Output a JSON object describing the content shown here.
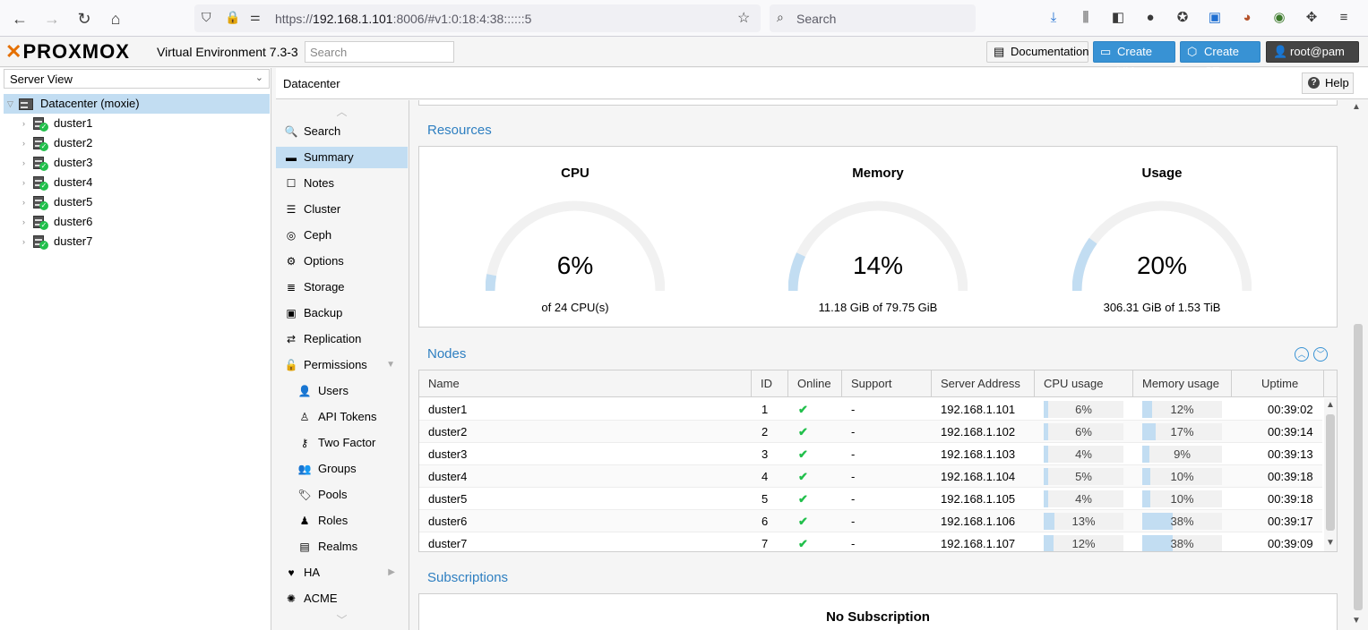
{
  "browser": {
    "url_prefix": "https://",
    "url_host": "192.168.1.101",
    "url_rest": ":8006/#v1:0:18:4:38::::::5",
    "search_placeholder": "Search"
  },
  "header": {
    "logo": "PROXMOX",
    "version": "Virtual Environment 7.3-3",
    "search_placeholder": "Search",
    "doc_label": "Documentation",
    "create_vm_label": "Create VM",
    "create_ct_label": "Create CT",
    "user_label": "root@pam"
  },
  "tree": {
    "view_label": "Server View",
    "datacenter_label": "Datacenter (moxie)",
    "nodes": [
      "duster1",
      "duster2",
      "duster3",
      "duster4",
      "duster5",
      "duster6",
      "duster7"
    ]
  },
  "content": {
    "title": "Datacenter",
    "help_label": "Help"
  },
  "menu": {
    "items": [
      {
        "label": "Search",
        "icon": "search-icon",
        "glyph": "🔍"
      },
      {
        "label": "Summary",
        "icon": "book-icon",
        "glyph": "▬",
        "selected": true
      },
      {
        "label": "Notes",
        "icon": "note-icon",
        "glyph": "☐"
      },
      {
        "label": "Cluster",
        "icon": "server-icon",
        "glyph": "☰"
      },
      {
        "label": "Ceph",
        "icon": "ceph-icon",
        "glyph": "◎"
      },
      {
        "label": "Options",
        "icon": "gear-icon",
        "glyph": "⚙"
      },
      {
        "label": "Storage",
        "icon": "database-icon",
        "glyph": "≣"
      },
      {
        "label": "Backup",
        "icon": "floppy-icon",
        "glyph": "▣"
      },
      {
        "label": "Replication",
        "icon": "retweet-icon",
        "glyph": "⇄"
      },
      {
        "label": "Permissions",
        "icon": "unlock-icon",
        "glyph": "🔓",
        "caret": "▼"
      },
      {
        "label": "Users",
        "icon": "user-icon",
        "glyph": "👤",
        "sub": true
      },
      {
        "label": "API Tokens",
        "icon": "user-outline-icon",
        "glyph": "♙",
        "sub": true
      },
      {
        "label": "Two Factor",
        "icon": "key-icon",
        "glyph": "⚷",
        "sub": true
      },
      {
        "label": "Groups",
        "icon": "users-icon",
        "glyph": "👥",
        "sub": true
      },
      {
        "label": "Pools",
        "icon": "tags-icon",
        "glyph": "🏷",
        "sub": true
      },
      {
        "label": "Roles",
        "icon": "male-icon",
        "glyph": "♟",
        "sub": true
      },
      {
        "label": "Realms",
        "icon": "address-book-icon",
        "glyph": "▤",
        "sub": true
      },
      {
        "label": "HA",
        "icon": "heartbeat-icon",
        "glyph": "♥",
        "caret": "▶"
      },
      {
        "label": "ACME",
        "icon": "certificate-icon",
        "glyph": "✺"
      }
    ]
  },
  "resources": {
    "title": "Resources",
    "gauges": [
      {
        "title": "CPU",
        "value": "6%",
        "fraction": 0.06,
        "sub": "of 24 CPU(s)"
      },
      {
        "title": "Memory",
        "value": "14%",
        "fraction": 0.14,
        "sub": "11.18 GiB of 79.75 GiB"
      },
      {
        "title": "Usage",
        "value": "20%",
        "fraction": 0.2,
        "sub": "306.31 GiB of 1.53 TiB"
      }
    ],
    "gauge_color": "#c2ddf2",
    "track_color": "#f1f1f1"
  },
  "nodes": {
    "title": "Nodes",
    "columns": [
      "Name",
      "ID",
      "Online",
      "Support",
      "Server Address",
      "CPU usage",
      "Memory usage",
      "Uptime"
    ],
    "rows": [
      {
        "name": "duster1",
        "id": "1",
        "online": "✔",
        "support": "-",
        "address": "192.168.1.101",
        "cpu": "6%",
        "cpu_f": 0.06,
        "mem": "12%",
        "mem_f": 0.12,
        "uptime": "00:39:02"
      },
      {
        "name": "duster2",
        "id": "2",
        "online": "✔",
        "support": "-",
        "address": "192.168.1.102",
        "cpu": "6%",
        "cpu_f": 0.06,
        "mem": "17%",
        "mem_f": 0.17,
        "uptime": "00:39:14"
      },
      {
        "name": "duster3",
        "id": "3",
        "online": "✔",
        "support": "-",
        "address": "192.168.1.103",
        "cpu": "4%",
        "cpu_f": 0.04,
        "mem": "9%",
        "mem_f": 0.09,
        "uptime": "00:39:13"
      },
      {
        "name": "duster4",
        "id": "4",
        "online": "✔",
        "support": "-",
        "address": "192.168.1.104",
        "cpu": "5%",
        "cpu_f": 0.05,
        "mem": "10%",
        "mem_f": 0.1,
        "uptime": "00:39:18"
      },
      {
        "name": "duster5",
        "id": "5",
        "online": "✔",
        "support": "-",
        "address": "192.168.1.105",
        "cpu": "4%",
        "cpu_f": 0.04,
        "mem": "10%",
        "mem_f": 0.1,
        "uptime": "00:39:18"
      },
      {
        "name": "duster6",
        "id": "6",
        "online": "✔",
        "support": "-",
        "address": "192.168.1.106",
        "cpu": "13%",
        "cpu_f": 0.13,
        "mem": "38%",
        "mem_f": 0.38,
        "uptime": "00:39:17"
      },
      {
        "name": "duster7",
        "id": "7",
        "online": "✔",
        "support": "-",
        "address": "192.168.1.107",
        "cpu": "12%",
        "cpu_f": 0.12,
        "mem": "38%",
        "mem_f": 0.38,
        "uptime": "00:39:09"
      }
    ]
  },
  "subscriptions": {
    "title": "Subscriptions",
    "status": "No Subscription"
  }
}
